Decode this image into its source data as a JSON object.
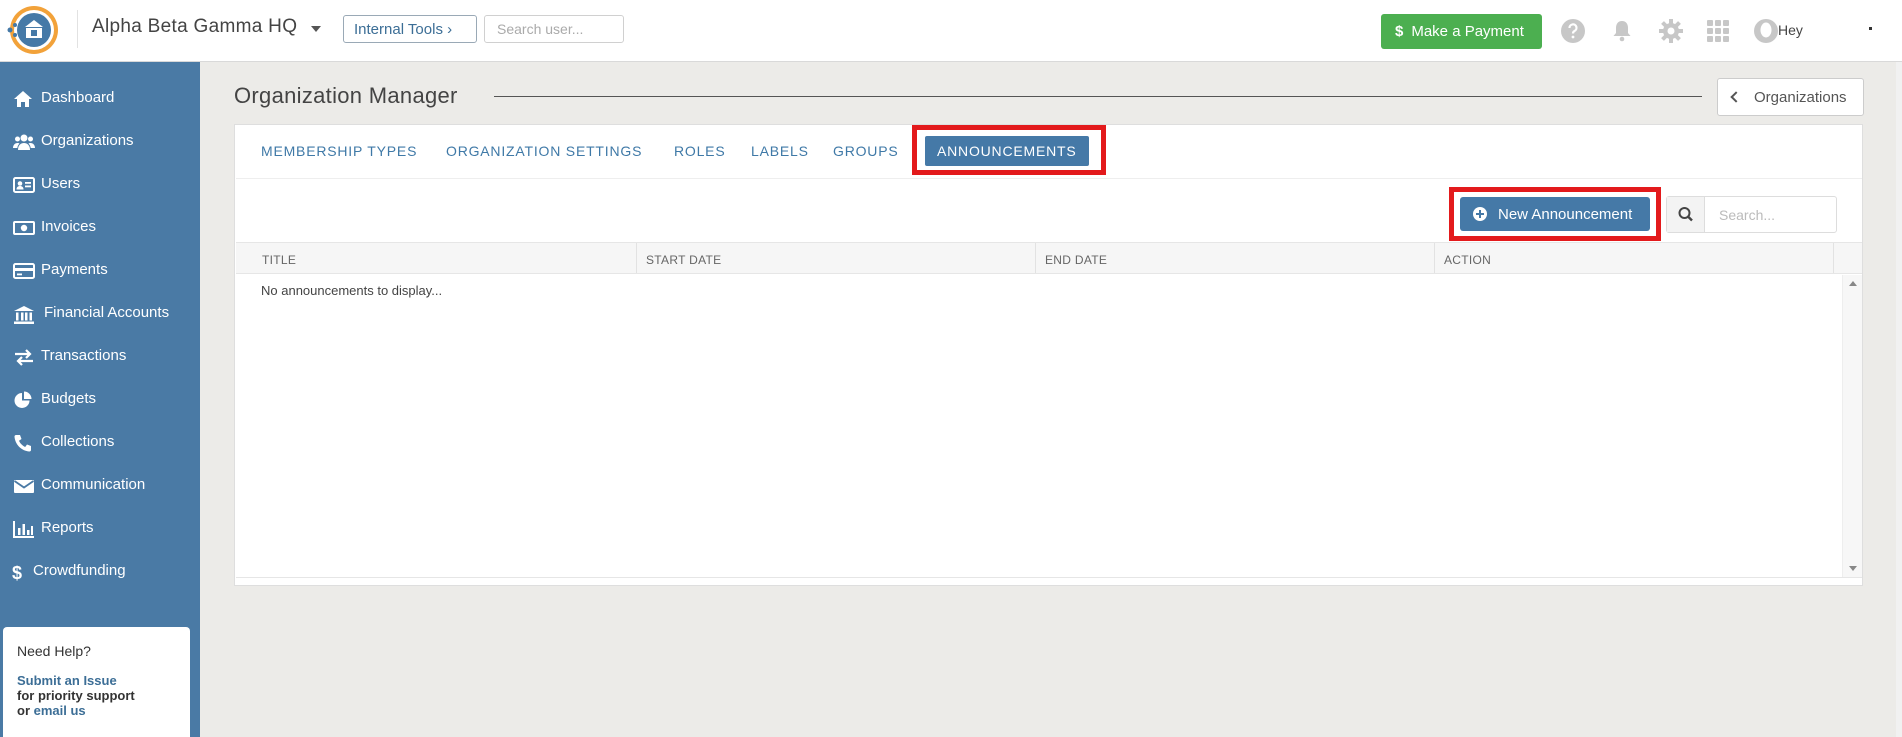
{
  "header": {
    "org_name": "Alpha Beta Gamma HQ",
    "internal_tools": "Internal Tools ›",
    "search_placeholder": "Search user...",
    "pay_label": "Make a Payment",
    "pay_symbol": "$",
    "greeting": "Hey"
  },
  "sidebar": {
    "items": [
      {
        "label": "Dashboard",
        "icon": "home-icon"
      },
      {
        "label": "Organizations",
        "icon": "users-group-icon"
      },
      {
        "label": "Users",
        "icon": "id-card-icon"
      },
      {
        "label": "Invoices",
        "icon": "money-icon"
      },
      {
        "label": "Payments",
        "icon": "credit-card-icon"
      },
      {
        "label": "Financial Accounts",
        "icon": "bank-icon"
      },
      {
        "label": "Transactions",
        "icon": "exchange-icon"
      },
      {
        "label": "Budgets",
        "icon": "pie-chart-icon"
      },
      {
        "label": "Collections",
        "icon": "phone-icon"
      },
      {
        "label": "Communication",
        "icon": "envelope-icon"
      },
      {
        "label": "Reports",
        "icon": "bar-chart-icon"
      },
      {
        "label": "Crowdfunding",
        "icon": "dollar-icon"
      }
    ],
    "help": {
      "title": "Need Help?",
      "submit_link": "Submit an Issue",
      "priority_text": "for priority support",
      "or_text": "or",
      "email_link": "email us"
    }
  },
  "main": {
    "title": "Organization Manager",
    "back_label": "Organizations",
    "tabs": [
      {
        "label": "MEMBERSHIP TYPES"
      },
      {
        "label": "ORGANIZATION SETTINGS"
      },
      {
        "label": "ROLES"
      },
      {
        "label": "LABELS"
      },
      {
        "label": "GROUPS"
      },
      {
        "label": "ANNOUNCEMENTS",
        "active": true
      }
    ],
    "new_button": "New Announcement",
    "search_placeholder": "Search...",
    "columns": [
      "TITLE",
      "START DATE",
      "END DATE",
      "ACTION"
    ],
    "empty_message": "No announcements to display..."
  },
  "colors": {
    "sidebar": "#4a7aa5",
    "accent": "#4579a7",
    "pay_green": "#4caf50",
    "highlight_red": "#e31a1c"
  }
}
